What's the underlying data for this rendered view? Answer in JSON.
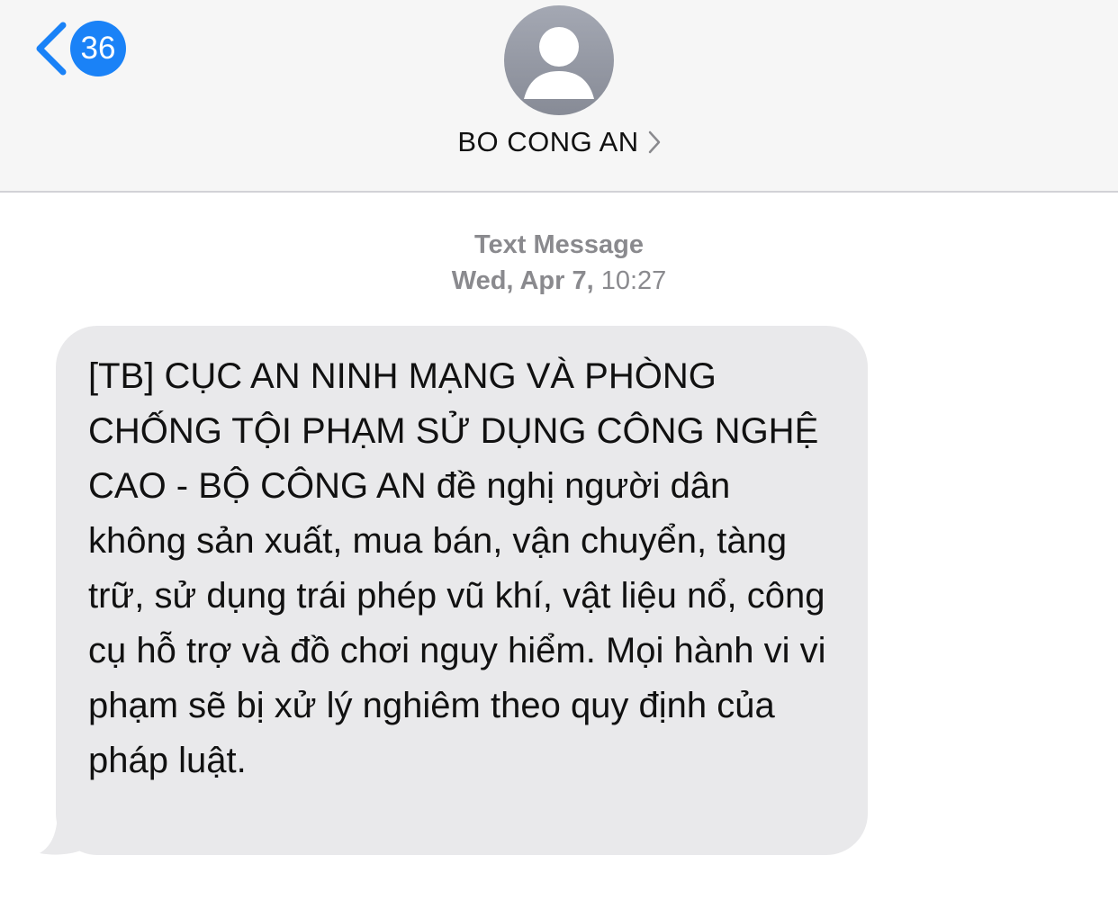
{
  "header": {
    "back_badge": "36",
    "contact_name": "BO CONG AN"
  },
  "icons": {
    "back": "chevron-left-icon",
    "avatar": "person-avatar-icon",
    "contact_detail": "chevron-right-icon"
  },
  "colors": {
    "accent": "#1a82f7",
    "header_bg": "#f6f6f6",
    "bubble_bg": "#e9e9eb",
    "meta_text": "#8a8a8e"
  },
  "thread": {
    "service_label": "Text Message",
    "date_label": "Wed, Apr 7,",
    "time_label": "10:27"
  },
  "message": {
    "text": "[TB] CỤC AN NINH MẠNG VÀ PHÒNG CHỐNG TỘI PHẠM SỬ DỤNG CÔNG NGHỆ CAO - BỘ CÔNG AN đề nghị người dân không sản xuất, mua bán, vận chuyển, tàng trữ, sử dụng trái phép vũ khí, vật liệu nổ, công cụ hỗ trợ và đồ chơi nguy hiểm. Mọi hành vi vi phạm sẽ bị xử lý nghiêm theo quy định của pháp luật."
  }
}
